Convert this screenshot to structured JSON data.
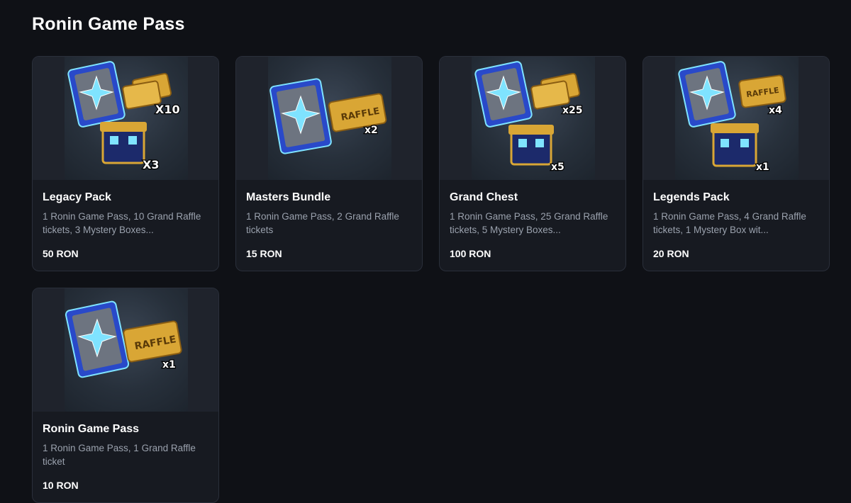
{
  "page": {
    "title": "Ronin Game Pass"
  },
  "cards": [
    {
      "name": "Legacy Pack",
      "description": "1 Ronin Game Pass, 10 Grand Raffle tickets, 3 Mystery Boxes...",
      "price": "50 RON",
      "image": {
        "icons": [
          "scroll-icon",
          "raffle-ticket-icon",
          "mystery-box-icon"
        ],
        "ticket_qty": "X10",
        "box_qty": "X3"
      }
    },
    {
      "name": "Masters Bundle",
      "description": "1 Ronin Game Pass, 2 Grand Raffle tickets",
      "price": "15 RON",
      "image": {
        "icons": [
          "scroll-icon",
          "raffle-ticket-icon"
        ],
        "ticket_qty": "x2",
        "ticket_text": "RAFFLE"
      }
    },
    {
      "name": "Grand Chest",
      "description": "1 Ronin Game Pass, 25 Grand Raffle tickets, 5 Mystery Boxes...",
      "price": "100 RON",
      "image": {
        "icons": [
          "scroll-icon",
          "raffle-ticket-icon",
          "mystery-box-icon"
        ],
        "ticket_qty": "x25",
        "box_qty": "x5"
      }
    },
    {
      "name": "Legends Pack",
      "description": "1 Ronin Game Pass, 4 Grand Raffle tickets, 1 Mystery Box wit...",
      "price": "20 RON",
      "image": {
        "icons": [
          "scroll-icon",
          "raffle-ticket-icon",
          "mystery-box-icon"
        ],
        "ticket_qty": "x4",
        "box_qty": "x1",
        "ticket_text": "RAFFLE"
      }
    },
    {
      "name": "Ronin Game Pass",
      "description": "1 Ronin Game Pass, 1 Grand Raffle ticket",
      "price": "10 RON",
      "image": {
        "icons": [
          "scroll-icon",
          "raffle-ticket-icon"
        ],
        "ticket_qty": "x1",
        "ticket_text": "RAFFLE"
      }
    }
  ],
  "colors": {
    "background": "#0f1116",
    "card": "#171a21",
    "card_border": "#2a2f3a",
    "muted_text": "#9aa1ad",
    "gold": "#d9a635",
    "scroll_blue": "#2949c9",
    "crystal": "#7fe3ff"
  }
}
